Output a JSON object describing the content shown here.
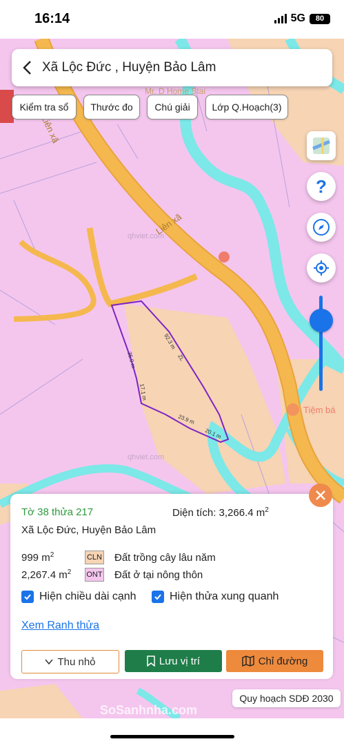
{
  "status": {
    "time": "16:14",
    "network": "5G",
    "battery": "80"
  },
  "header": {
    "title": "Xã Lộc Đức , Huyện Bảo Lâm"
  },
  "toolbar": {
    "check_label": "Kiểm tra sổ",
    "ruler_label": "Thước đo",
    "legend_label": "Chú giải",
    "layer_label": "Lớp Q.Hoạch(3)"
  },
  "map": {
    "watermark": "qhviet.com",
    "road_name": "Liên xã",
    "poi_homestay": "Mr. D Home Stai",
    "poi_shop": "Tiệm bá",
    "edges": [
      "92.3 m",
      "35.0 m",
      "17.1 m",
      "23.9 m",
      "20.1 m"
    ],
    "parcel_code": "ZL",
    "colors": {
      "pink": "#f4c6ee",
      "road": "#f2b24a",
      "river": "#7ce8e8",
      "peach": "#f6d4b4",
      "boundary": "#7d24c4"
    }
  },
  "controls": {
    "help": "?",
    "zoom_level": 0.85
  },
  "panel": {
    "parcel_id": "Tờ 38 thửa 217",
    "area_label": "Diện tích: 3,266.4 m",
    "area_unit_power": "2",
    "location": "Xã Lộc Đức, Huyện Bảo Lâm",
    "land_uses": [
      {
        "area": "999 m",
        "power": "2",
        "code": "CLN",
        "name": "Đất trồng cây lâu năm",
        "color": "#f6d4b4"
      },
      {
        "area": "2,267.4 m",
        "power": "2",
        "code": "ONT",
        "name": "Đất ở tại nông thôn",
        "color": "#f4c6ee"
      }
    ],
    "show_edges": "Hiện chiều dài cạnh",
    "show_neighbors": "Hiện thửa xung quanh",
    "view_boundary": "Xem Ranh thửa",
    "btn_collapse": "Thu nhỏ",
    "btn_save": "Lưu vị trí",
    "btn_directions": "Chỉ đường"
  },
  "plan_tag": "Quy hoạch SDĐ 2030",
  "brand_watermark": "SoSanhnha.com"
}
